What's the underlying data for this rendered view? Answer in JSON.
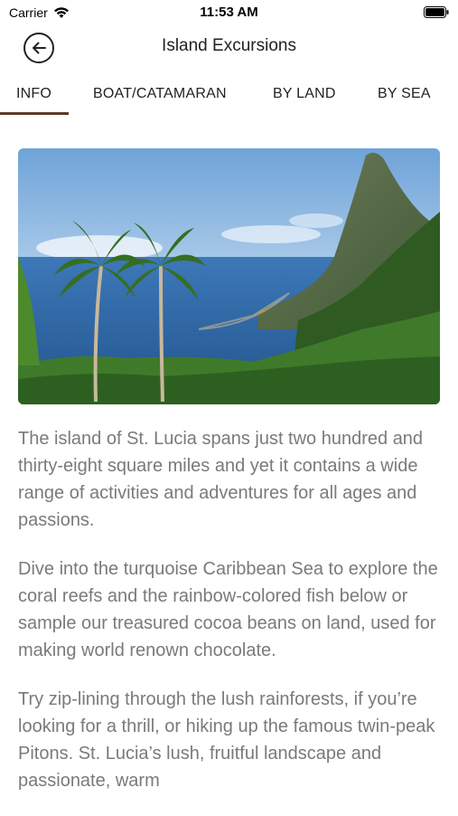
{
  "status_bar": {
    "carrier": "Carrier",
    "time": "11:53 AM",
    "icons": [
      "wifi-icon",
      "battery-icon"
    ]
  },
  "nav": {
    "title": "Island Excursions",
    "back_icon": "back-arrow-icon"
  },
  "tabs": [
    {
      "label": "INFO",
      "active": true
    },
    {
      "label": "BOAT/CATAMARAN",
      "active": false
    },
    {
      "label": "BY LAND",
      "active": false
    },
    {
      "label": "BY SEA",
      "active": false
    }
  ],
  "colors": {
    "accent": "#5a3a26",
    "body_text": "#7a7a7a"
  },
  "paragraphs": [
    "The island of St. Lucia spans just two hundred and thirty-eight square miles and yet it contains a wide range of activities and adventures for all ages and passions.",
    "Dive into the turquoise Caribbean Sea to explore the coral reefs and the rainbow-colored fish below or sample our treasured cocoa beans on land, used for making world renown chocolate.",
    "Try zip-lining through the lush rainforests, if you’re looking for a thrill, or hiking up the famous twin-peak Pitons. St. Lucia’s lush, fruitful landscape and passionate, warm"
  ]
}
